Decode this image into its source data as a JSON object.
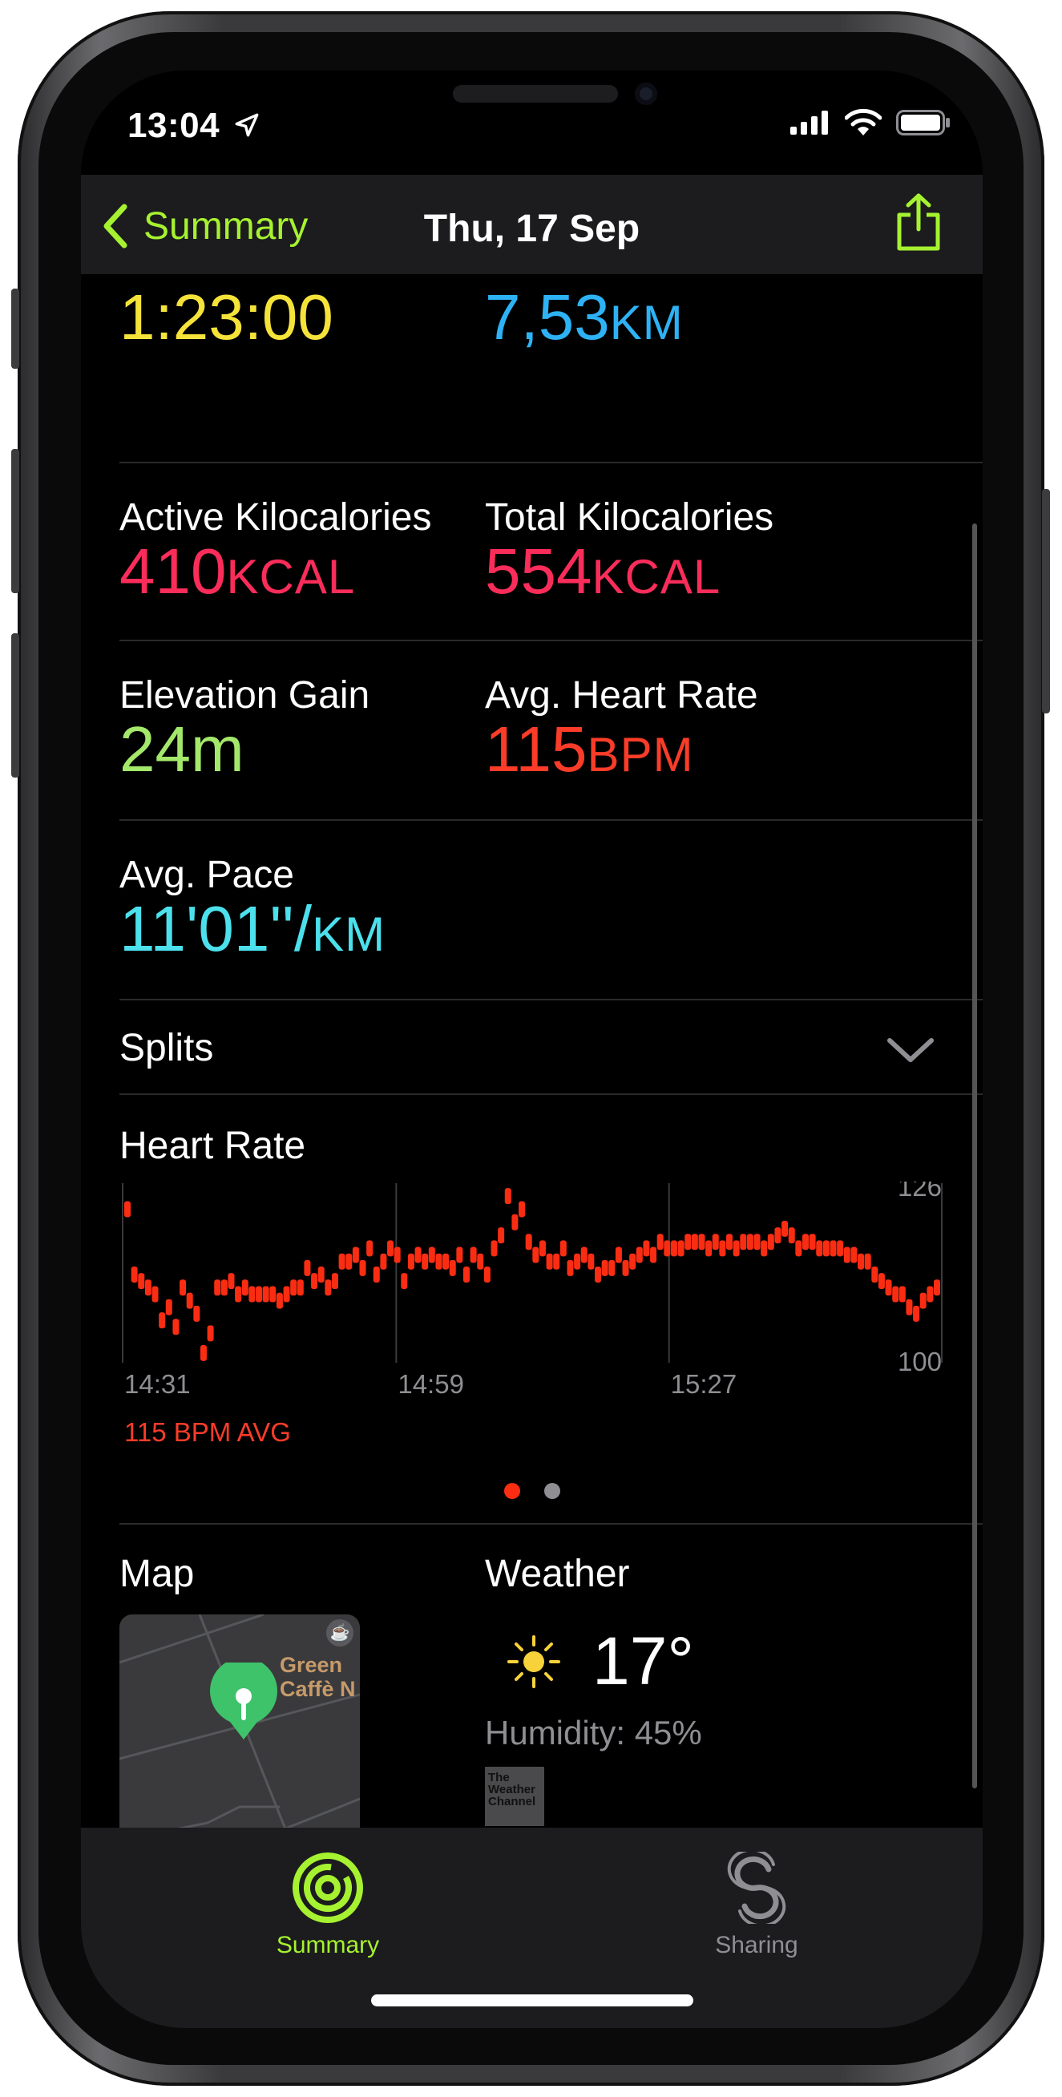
{
  "status": {
    "time": "13:04"
  },
  "nav": {
    "back_label": "Summary",
    "title": "Thu, 17 Sep"
  },
  "metrics": {
    "duration": {
      "value": "1:23:00",
      "color": "#f5e33a"
    },
    "distance": {
      "value": "7,53",
      "unit": "KM",
      "color": "#2db2f5"
    },
    "active_kcal": {
      "label": "Active Kilocalories",
      "value": "410",
      "unit": "KCAL",
      "color": "#fa2d5a"
    },
    "total_kcal": {
      "label": "Total Kilocalories",
      "value": "554",
      "unit": "KCAL",
      "color": "#fa2d5a"
    },
    "elevation": {
      "label": "Elevation Gain",
      "value": "24m",
      "color": "#a4e86b"
    },
    "avg_hr": {
      "label": "Avg. Heart Rate",
      "value": "115",
      "unit": "BPM",
      "color": "#fa3c28"
    },
    "avg_pace": {
      "label": "Avg. Pace",
      "value": "11'01''/",
      "unit": "KM",
      "color": "#4ce0ec"
    }
  },
  "splits": {
    "label": "Splits"
  },
  "heart_rate": {
    "title": "Heart Rate",
    "avg_label": "115 BPM AVG",
    "y_max_label": "126",
    "y_min_label": "100",
    "x_labels": [
      "14:31",
      "14:59",
      "15:27"
    ],
    "pager": {
      "pages": 2,
      "active": 0
    }
  },
  "chart_data": {
    "type": "scatter",
    "title": "Heart Rate",
    "ylim": [
      100,
      126
    ],
    "xlabel": "",
    "ylabel": "",
    "x_ticks": [
      "14:31",
      "14:59",
      "15:27"
    ],
    "series": [
      {
        "values": [
          123,
          113,
          112,
          111,
          110,
          106,
          108,
          105,
          111,
          109,
          107,
          101,
          104,
          111,
          111,
          112,
          110,
          111,
          110,
          110,
          110,
          110,
          109,
          110,
          111,
          111,
          114,
          112,
          113,
          111,
          112,
          115,
          115,
          116,
          114,
          117,
          113,
          115,
          117,
          116,
          112,
          115,
          116,
          115,
          116,
          115,
          115,
          114,
          116,
          113,
          116,
          115,
          113,
          117,
          119,
          125,
          121,
          123,
          118,
          116,
          117,
          115,
          115,
          117,
          114,
          115,
          116,
          115,
          113,
          114,
          114,
          116,
          114,
          115,
          116,
          117,
          116,
          118,
          117,
          117,
          117,
          118,
          118,
          118,
          117,
          118,
          117,
          118,
          117,
          118,
          118,
          118,
          117,
          118,
          119,
          120,
          119,
          117,
          118,
          118,
          117,
          117,
          117,
          117,
          116,
          116,
          115,
          115,
          113,
          112,
          111,
          110,
          110,
          108,
          107,
          109,
          110,
          111
        ]
      }
    ]
  },
  "map": {
    "label": "Map",
    "poi": "Green Caffè N"
  },
  "weather": {
    "label": "Weather",
    "temperature": "17°",
    "humidity": "Humidity: 45%",
    "provider": "The Weather Channel"
  },
  "tabs": [
    {
      "label": "Summary",
      "active": true
    },
    {
      "label": "Sharing",
      "active": false
    }
  ],
  "colors": {
    "accent": "#a6f230",
    "hr": "#fa2d12",
    "grey": "#8e8e93"
  }
}
